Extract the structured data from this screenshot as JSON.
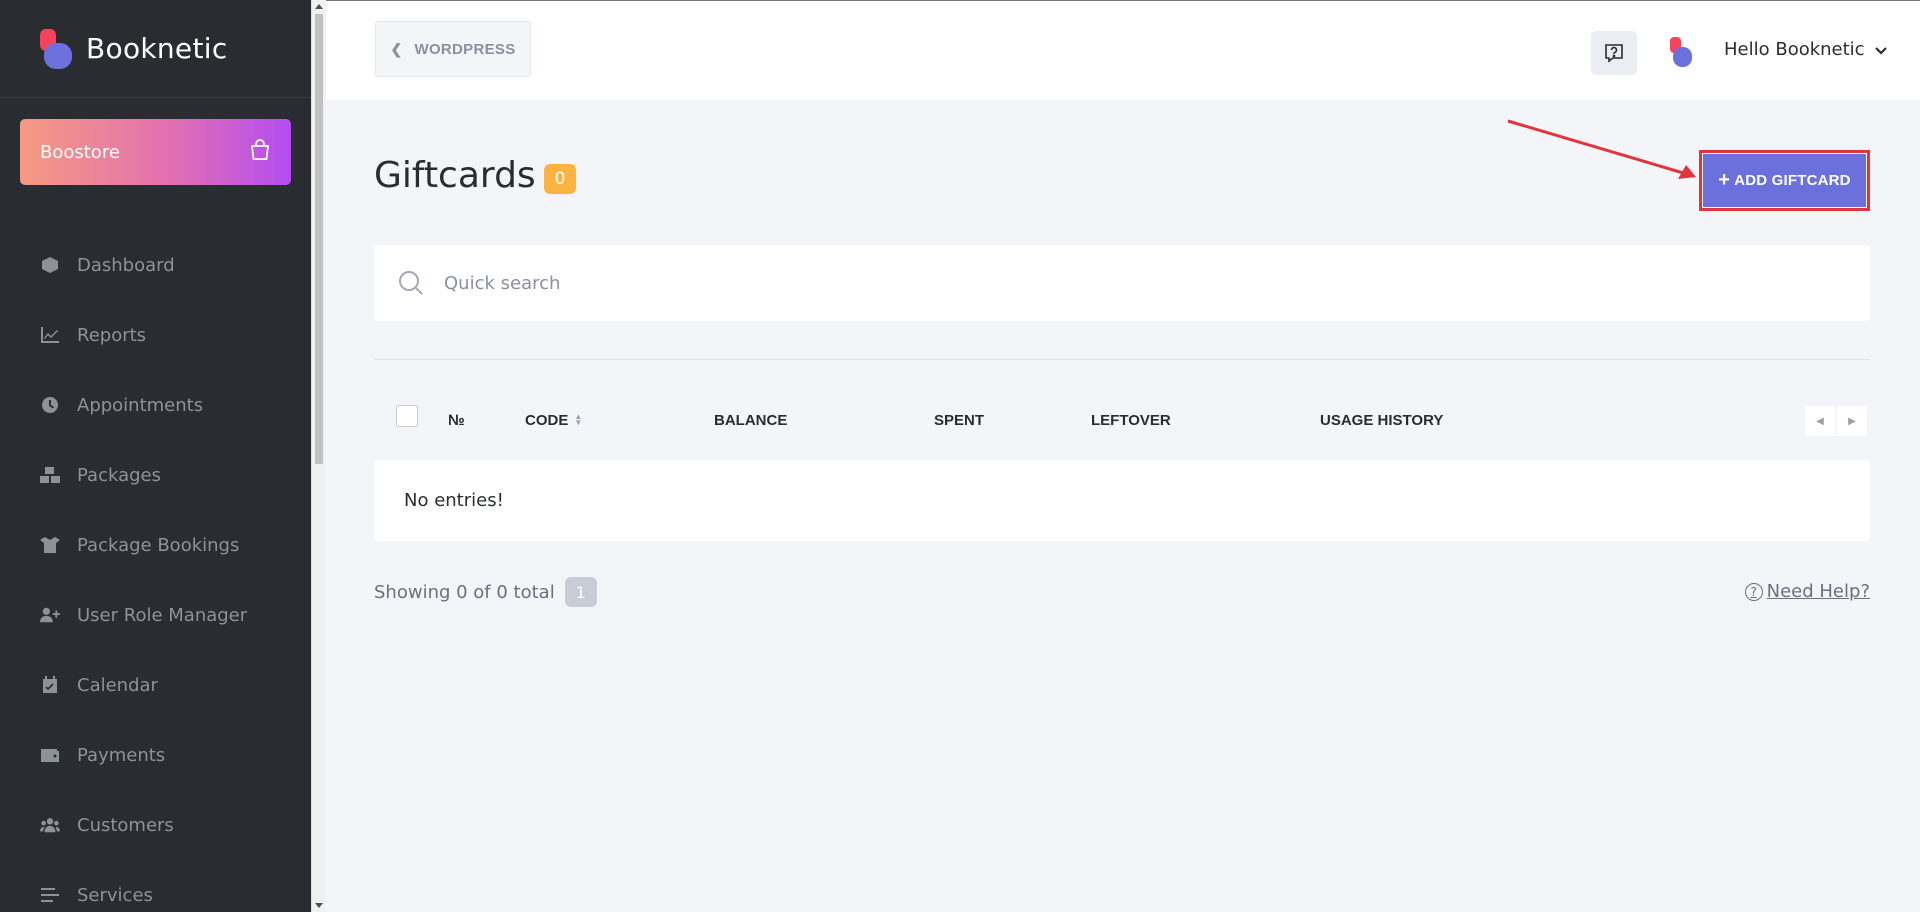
{
  "brand": {
    "name": "Booknetic"
  },
  "boostore": {
    "label": "Boostore"
  },
  "menu": [
    {
      "label": "Dashboard",
      "icon": "cube-icon"
    },
    {
      "label": "Reports",
      "icon": "chart-line-icon"
    },
    {
      "label": "Appointments",
      "icon": "clock-icon"
    },
    {
      "label": "Packages",
      "icon": "boxes-icon"
    },
    {
      "label": "Package Bookings",
      "icon": "box-open-icon"
    },
    {
      "label": "User Role Manager",
      "icon": "user-plus-icon"
    },
    {
      "label": "Calendar",
      "icon": "calendar-icon"
    },
    {
      "label": "Payments",
      "icon": "wallet-icon"
    },
    {
      "label": "Customers",
      "icon": "users-icon"
    },
    {
      "label": "Services",
      "icon": "list-icon"
    }
  ],
  "topbar": {
    "wordpress_label": "WORDPRESS",
    "user_greeting": "Hello Booknetic"
  },
  "page": {
    "title": "Giftcards",
    "count": "0",
    "add_button": "ADD GIFTCARD"
  },
  "search": {
    "placeholder": "Quick search"
  },
  "table": {
    "headers": {
      "number": "№",
      "code": "CODE",
      "balance": "BALANCE",
      "spent": "SPENT",
      "leftover": "LEFTOVER",
      "usage_history": "USAGE HISTORY"
    },
    "empty_message": "No entries!"
  },
  "footer": {
    "showing": "Showing 0 of 0 total",
    "page": "1",
    "need_help": "Need Help?"
  },
  "colors": {
    "sidebar_bg": "#292d32",
    "accent": "#6c70dc",
    "badge": "#fbb441",
    "highlight": "#e0353c"
  }
}
